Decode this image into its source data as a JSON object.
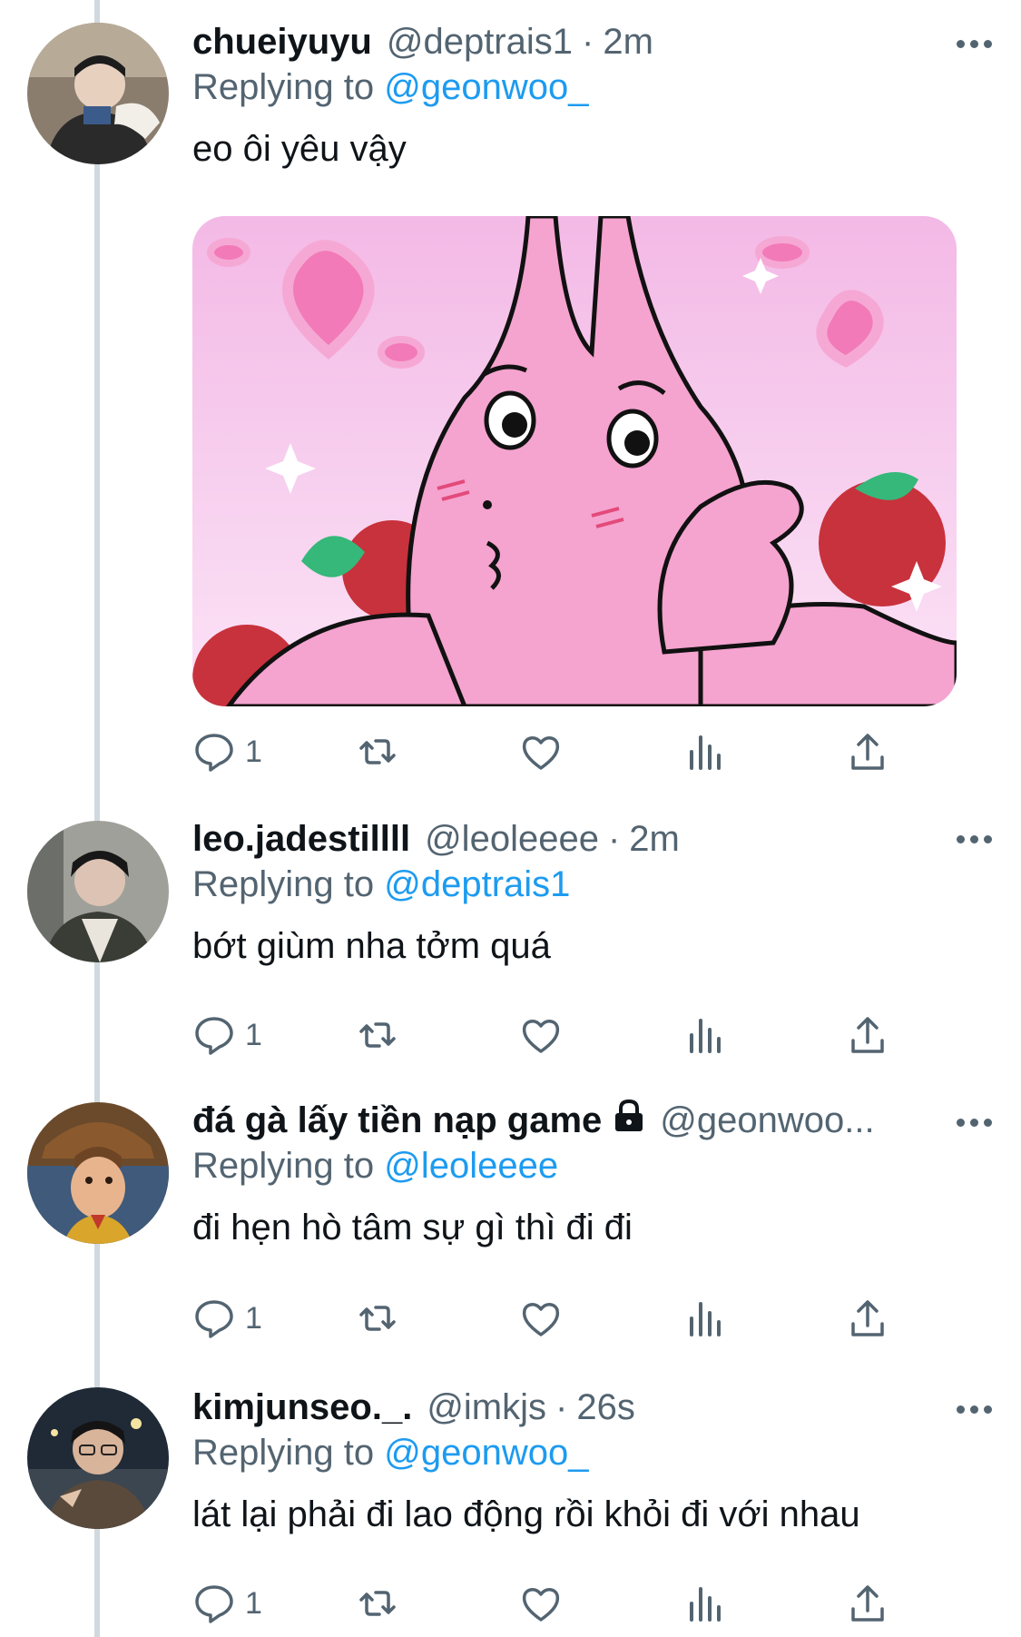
{
  "tweets": [
    {
      "name": "chueiyuyu",
      "handle": "@deptrais1",
      "time": "2m",
      "replying_prefix": "Replying to",
      "replying_to": "@geonwoo_",
      "text": "eo ôi yêu vậy",
      "reply_count": "1",
      "has_media": true
    },
    {
      "name": "leo.jadestillll",
      "handle": "@leoleeee",
      "time": "2m",
      "replying_prefix": "Replying to",
      "replying_to": "@deptrais1",
      "text": "bớt giùm nha tởm quá",
      "reply_count": "1"
    },
    {
      "name": "đá gà lấy tiền nạp game",
      "handle": "@geonwoo...",
      "protected": true,
      "replying_prefix": "Replying to",
      "replying_to": "@leoleeee",
      "text": "đi hẹn hò tâm sự gì thì đi đi",
      "reply_count": "1"
    },
    {
      "name": "kimjunseo._.",
      "handle": "@imkjs",
      "time": "26s",
      "replying_prefix": "Replying to",
      "replying_to": "@geonwoo_",
      "text": "lát lại phải đi lao động rồi khỏi đi với nhau",
      "reply_count": "1"
    }
  ],
  "icons": [
    "reply-icon",
    "retweet-icon",
    "like-icon",
    "analytics-icon",
    "share-icon",
    "more-icon",
    "lock-icon"
  ],
  "colors": {
    "link": "#1d9bf0",
    "secondary_text": "#536471",
    "thread_line": "#cfd9de",
    "media_bg": "#f7c0e6"
  }
}
